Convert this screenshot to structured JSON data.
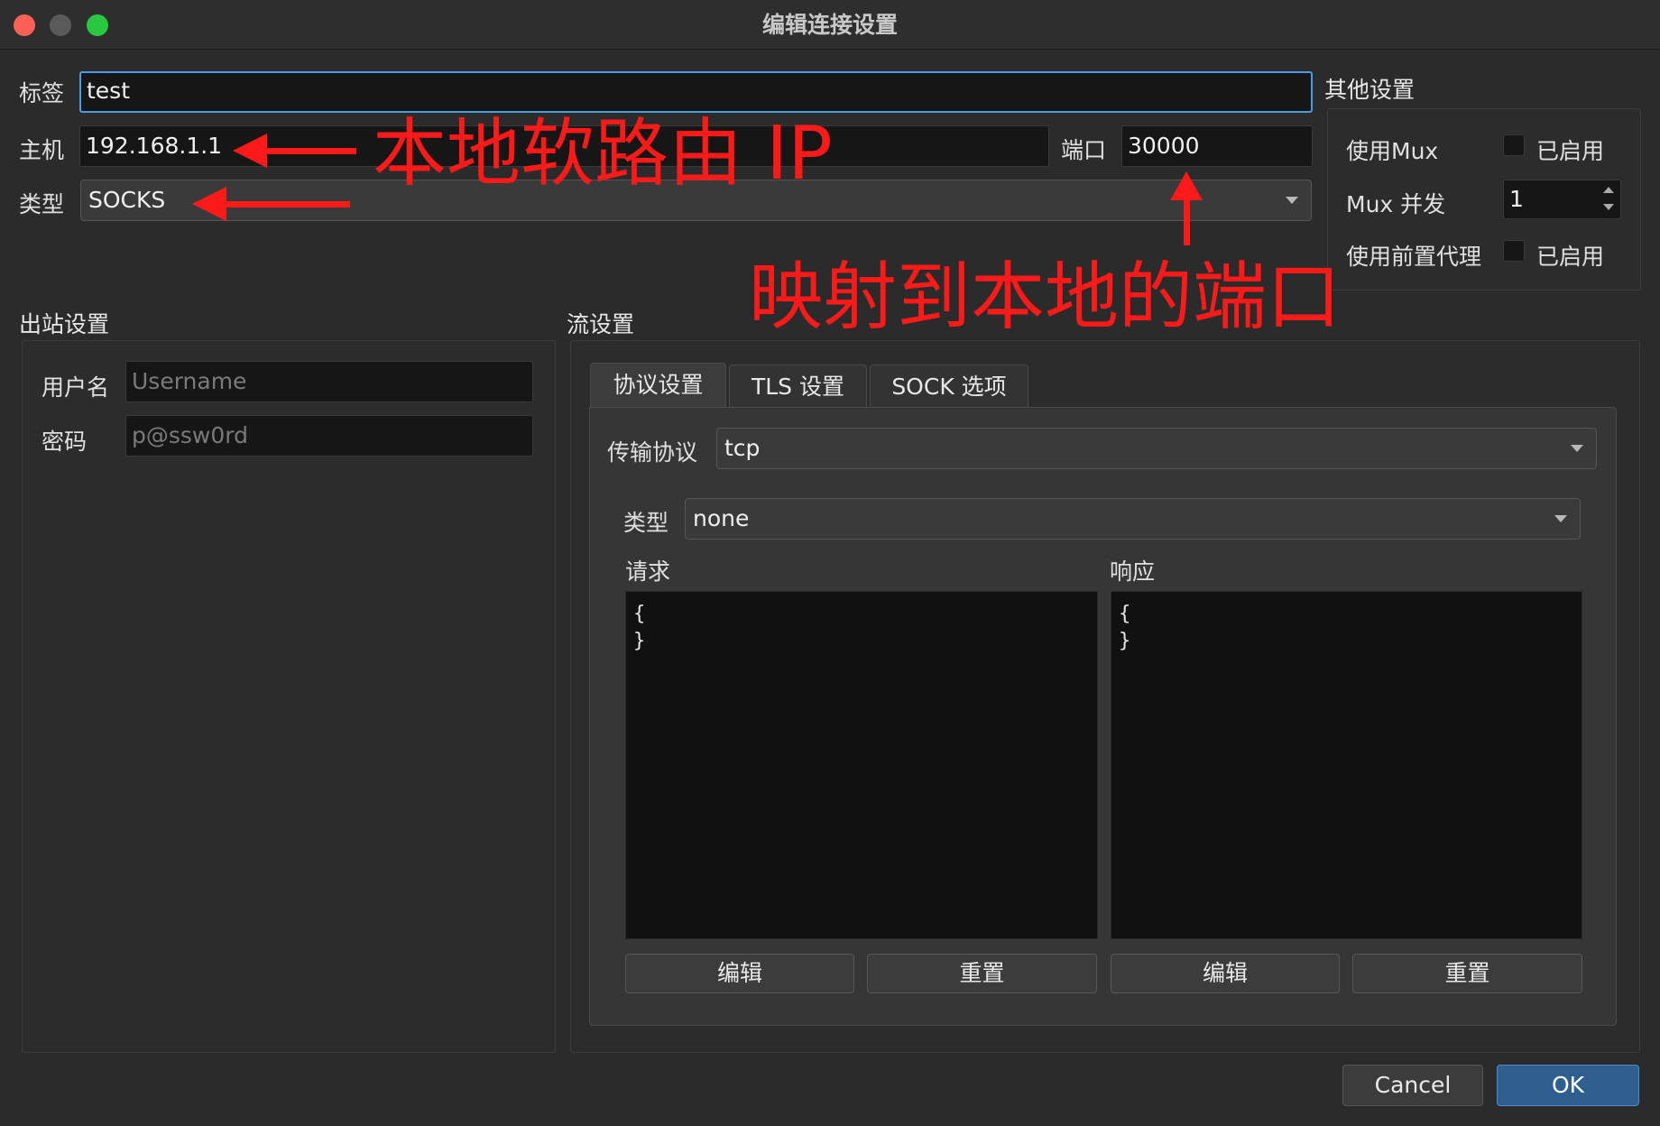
{
  "window": {
    "title": "编辑连接设置"
  },
  "top": {
    "tag_label": "标签",
    "tag_value": "test",
    "host_label": "主机",
    "host_value": "192.168.1.1",
    "port_label": "端口",
    "port_value": "30000",
    "type_label": "类型",
    "type_value": "SOCKS"
  },
  "other": {
    "title": "其他设置",
    "mux_label": "使用Mux",
    "mux_check": "已启用",
    "mux_concurrency_label": "Mux 并发",
    "mux_concurrency_value": "1",
    "proxy_label": "使用前置代理",
    "proxy_check": "已启用"
  },
  "outbound": {
    "title": "出站设置",
    "username_label": "用户名",
    "username_placeholder": "Username",
    "password_label": "密码",
    "password_placeholder": "p@ssw0rd"
  },
  "stream": {
    "title": "流设置",
    "tabs": [
      {
        "label": "协议设置"
      },
      {
        "label": "TLS 设置"
      },
      {
        "label": "SOCK 选项"
      }
    ],
    "transport_label": "传输协议",
    "transport_value": "tcp",
    "type_label": "类型",
    "type_value": "none",
    "request_label": "请求",
    "request_text": "{\n}",
    "response_label": "响应",
    "response_text": "{\n}",
    "edit_label": "编辑",
    "reset_label": "重置"
  },
  "buttons": {
    "cancel": "Cancel",
    "ok": "OK"
  },
  "annotations": {
    "host_note": "本地软路由 IP",
    "port_note": "映射到本地的端口",
    "color": "#ff1a1a"
  }
}
